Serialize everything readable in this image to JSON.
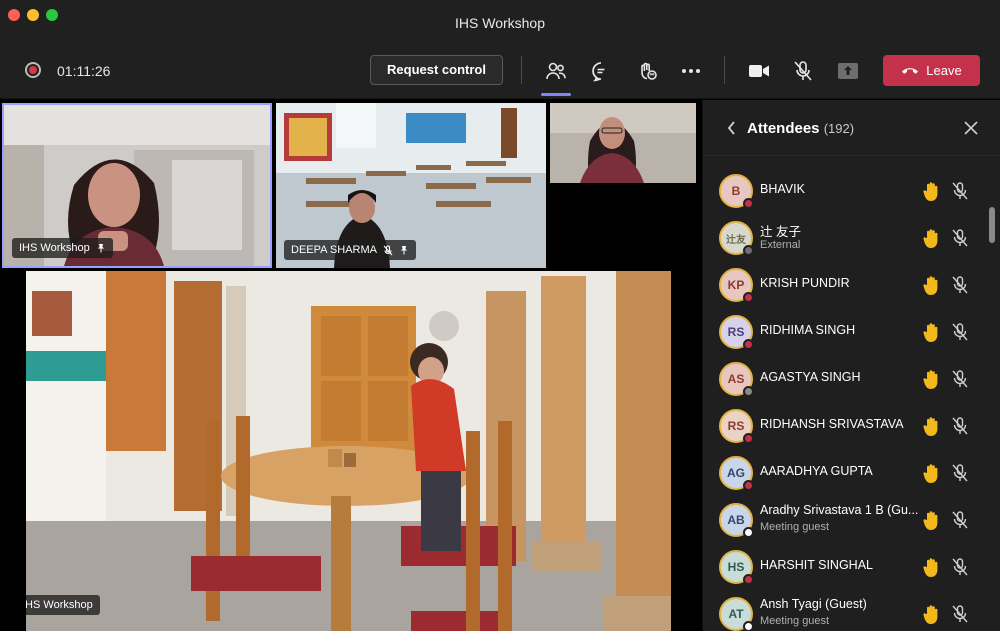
{
  "window": {
    "title": "IHS Workshop"
  },
  "toolbar": {
    "timer": "01:11:26",
    "request_control_label": "Request control",
    "leave_label": "Leave",
    "icons": [
      "participants-icon",
      "chat-icon",
      "reactions-icon",
      "more-options-icon",
      "camera-icon",
      "mic-off-icon",
      "share-tray-icon",
      "phone-icon"
    ],
    "accent": "#7f85f5",
    "leave_color": "#c4314b"
  },
  "stage": {
    "tiles": [
      {
        "label": "IHS Workshop",
        "pinned": true
      },
      {
        "label": "DEEPA SHARMA",
        "muted": true,
        "pinned": true
      },
      {
        "label": "",
        "muted": false
      },
      {
        "label": "IHS Workshop"
      }
    ]
  },
  "attendees": {
    "title": "Attendees",
    "count": "(192)",
    "list": [
      {
        "initials": "B",
        "name": "BHAVIK",
        "sub": ""
      },
      {
        "initials": "辻友",
        "name": "辻 友子",
        "sub": "External"
      },
      {
        "initials": "KP",
        "name": "KRISH PUNDIR",
        "sub": ""
      },
      {
        "initials": "RS",
        "name": "RIDHIMA SINGH",
        "sub": ""
      },
      {
        "initials": "AS",
        "name": "AGASTYA SINGH",
        "sub": ""
      },
      {
        "initials": "RS",
        "name": "RIDHANSH SRIVASTAVA",
        "sub": ""
      },
      {
        "initials": "AG",
        "name": "AARADHYA GUPTA",
        "sub": ""
      },
      {
        "initials": "AB",
        "name": "Aradhy Srivastava 1 B (Gu...",
        "sub": "Meeting guest"
      },
      {
        "initials": "HS",
        "name": "HARSHIT SINGHAL",
        "sub": ""
      },
      {
        "initials": "AT",
        "name": "Ansh Tyagi (Guest)",
        "sub": "Meeting guest"
      }
    ]
  }
}
